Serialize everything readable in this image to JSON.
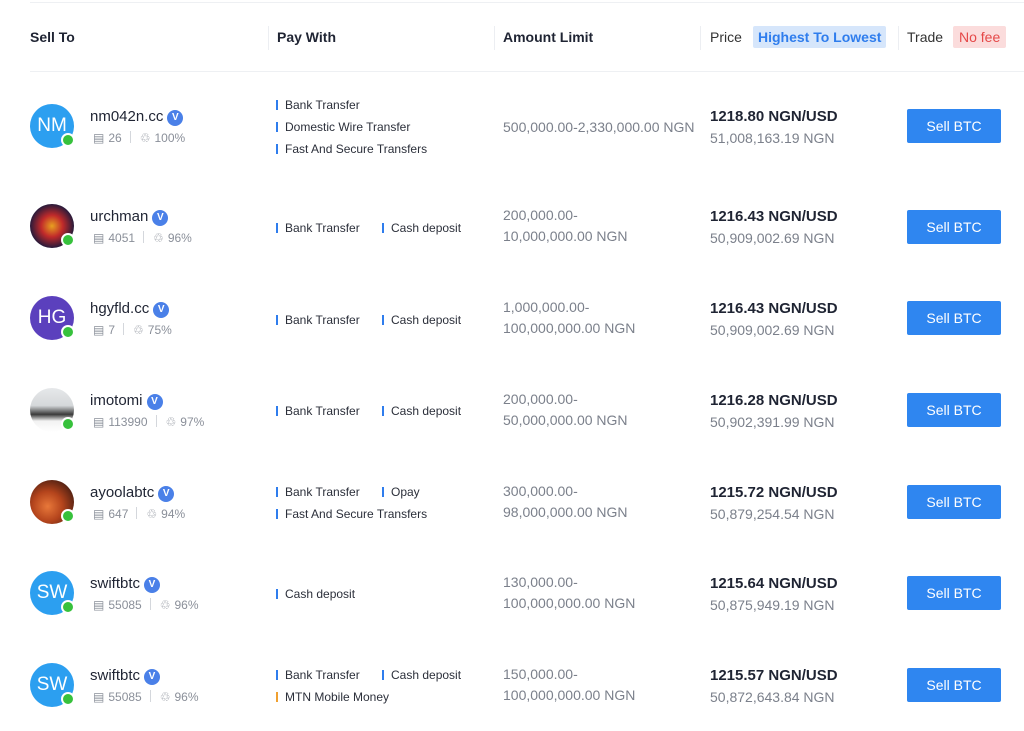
{
  "header": {
    "sell_to": "Sell To",
    "pay_with": "Pay With",
    "amount_limit": "Amount Limit",
    "price": "Price",
    "price_sort": "Highest To Lowest",
    "trade": "Trade",
    "trade_badge": "No fee"
  },
  "rows": [
    {
      "initials": "NM",
      "avatar_color": "#2c9ff0",
      "name": "nm042n.cc",
      "verified": "V",
      "trades": "26",
      "rate": "100%",
      "payments": [
        "Bank Transfer",
        "Domestic Wire Transfer",
        "Fast And Secure Transfers"
      ],
      "amount_line1": "500,000.00-2,330,000.00 NGN",
      "amount_line2": "",
      "price": "1218.80 NGN/USD",
      "sub": "51,008,163.19 NGN",
      "button": "Sell  BTC"
    },
    {
      "initials": "",
      "avatar_color": "#2a2018",
      "name": "urchman",
      "verified": "V",
      "trades": "4051",
      "rate": "96%",
      "payments": [
        "Bank Transfer",
        "Cash deposit"
      ],
      "amount_line1": "200,000.00-",
      "amount_line2": "10,000,000.00 NGN",
      "price": "1216.43 NGN/USD",
      "sub": "50,909,002.69 NGN",
      "button": "Sell  BTC"
    },
    {
      "initials": "HG",
      "avatar_color": "#5b40bd",
      "name": "hgyfld.cc",
      "verified": "V",
      "trades": "7",
      "rate": "75%",
      "payments": [
        "Bank Transfer",
        "Cash deposit"
      ],
      "amount_line1": "1,000,000.00-",
      "amount_line2": "100,000,000.00 NGN",
      "price": "1216.43 NGN/USD",
      "sub": "50,909,002.69 NGN",
      "button": "Sell  BTC"
    },
    {
      "initials": "",
      "avatar_color": "#cfd3d6",
      "name": "imotomi",
      "verified": "V",
      "trades": "113990",
      "rate": "97%",
      "payments": [
        "Bank Transfer",
        "Cash deposit"
      ],
      "amount_line1": "200,000.00-",
      "amount_line2": "50,000,000.00 NGN",
      "price": "1216.28 NGN/USD",
      "sub": "50,902,391.99 NGN",
      "button": "Sell  BTC"
    },
    {
      "initials": "",
      "avatar_color": "#7a3a22",
      "name": "ayoolabtc",
      "verified": "V",
      "trades": "647",
      "rate": "94%",
      "payments": [
        "Bank Transfer",
        "Opay",
        "Fast And Secure Transfers"
      ],
      "amount_line1": "300,000.00-",
      "amount_line2": "98,000,000.00 NGN",
      "price": "1215.72 NGN/USD",
      "sub": "50,879,254.54 NGN",
      "button": "Sell  BTC"
    },
    {
      "initials": "SW",
      "avatar_color": "#2c9ff0",
      "name": "swiftbtc",
      "verified": "V",
      "trades": "55085",
      "rate": "96%",
      "payments": [
        "Cash deposit"
      ],
      "amount_line1": "130,000.00-",
      "amount_line2": "100,000,000.00 NGN",
      "price": "1215.64 NGN/USD",
      "sub": "50,875,949.19 NGN",
      "button": "Sell  BTC"
    },
    {
      "initials": "SW",
      "avatar_color": "#2c9ff0",
      "name": "swiftbtc",
      "verified": "V",
      "trades": "55085",
      "rate": "96%",
      "payments": [
        "Bank Transfer",
        "Cash deposit",
        "MTN Mobile Money"
      ],
      "amount_line1": "150,000.00-",
      "amount_line2": "100,000,000.00 NGN",
      "price": "1215.57 NGN/USD",
      "sub": "50,872,643.84 NGN",
      "button": "Sell  BTC"
    }
  ]
}
